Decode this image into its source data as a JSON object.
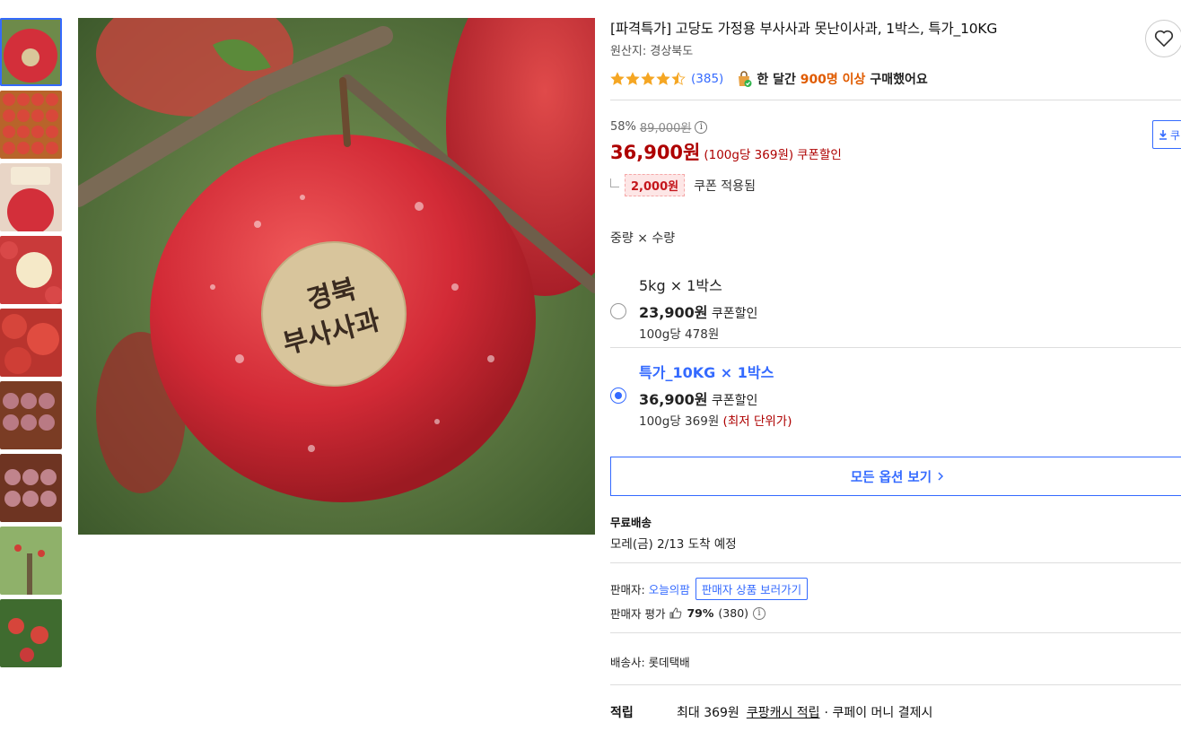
{
  "product": {
    "title": "[파격특가] 고당도 가정용 부사사과 못난이사과, 1박스, 특가_10KG",
    "origin": "원산지: 경상북도",
    "image_label": [
      "경북",
      "부사사과"
    ]
  },
  "rating": {
    "stars": 4.5,
    "review_count": "(385)",
    "purchase_prefix": "한 달간",
    "purchase_count": "900명 이상",
    "purchase_suffix": "구매했어요"
  },
  "price": {
    "discount_rate": "58%",
    "original": "89,000원",
    "sale": "36,900원",
    "unit": "(100g당 369원)",
    "coupon_label": "쿠폰할인",
    "coupon_amount": "2,000원",
    "coupon_applied": "쿠폰 적용됨",
    "download_label": "쿠"
  },
  "options": {
    "label": "중량 × 수량",
    "items": [
      {
        "name": "5kg × 1박스",
        "price": "23,900원",
        "coupon": "쿠폰할인",
        "unit": "100g당 478원",
        "badge": "",
        "selected": false
      },
      {
        "name": "특가_10KG × 1박스",
        "price": "36,900원",
        "coupon": "쿠폰할인",
        "unit": "100g당 369원",
        "badge": "(최저 단위가)",
        "selected": true
      }
    ],
    "all_button": "모든 옵션 보기"
  },
  "shipping": {
    "type": "무료배송",
    "eta": "모레(금) 2/13 도착 예정"
  },
  "seller": {
    "label": "판매자:",
    "name": "오늘의팜",
    "link": "판매자 상품 보러가기",
    "rating_label": "판매자 평가",
    "rating_value": "79%",
    "rating_count": "(380)"
  },
  "courier": "배송사: 롯데택배",
  "reward": {
    "label": "적립",
    "text": "최대 369원",
    "link": "쿠팡캐시 적립",
    "suffix": "· 쿠페이 머니 결제시"
  },
  "colors": {
    "accent": "#346aff",
    "price": "#ae0000",
    "star": "#f5a623",
    "purchase_highlight": "#e05b00"
  },
  "icons": [
    "heart-icon",
    "star-icon",
    "shopping-bag-icon",
    "info-icon",
    "thumbs-up-icon",
    "chevron-right-icon",
    "download-icon"
  ]
}
